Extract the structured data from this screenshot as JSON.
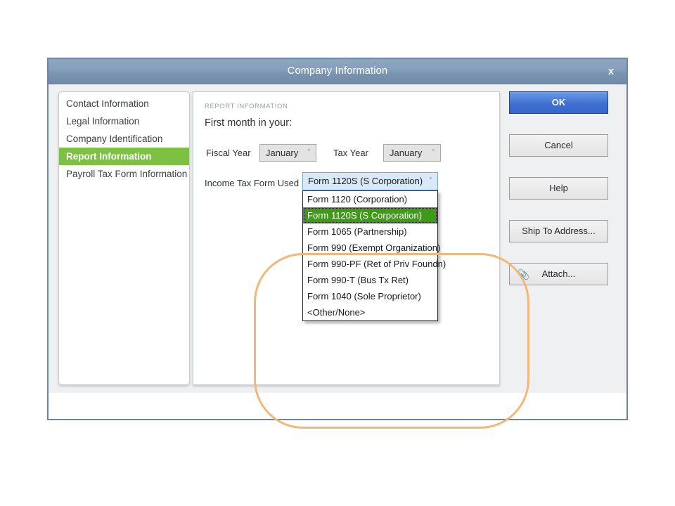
{
  "window": {
    "title": "Company Information",
    "close_label": "x"
  },
  "sidebar": {
    "items": [
      {
        "label": "Contact Information",
        "selected": false
      },
      {
        "label": "Legal Information",
        "selected": false
      },
      {
        "label": "Company Identification",
        "selected": false
      },
      {
        "label": "Report Information",
        "selected": true
      },
      {
        "label": "Payroll Tax Form Information",
        "selected": false
      }
    ]
  },
  "content": {
    "section_label": "REPORT INFORMATION",
    "heading": "First month in your:",
    "fiscal_year": {
      "label": "Fiscal Year",
      "value": "January",
      "caret": "ˇ"
    },
    "tax_year": {
      "label": "Tax Year",
      "value": "January",
      "caret": "ˇ"
    },
    "income_tax_form": {
      "label": "Income Tax Form Used",
      "value": "Form 1120S (S Corporation)",
      "caret": "ˇ",
      "options": [
        {
          "label": "Form 1120 (Corporation)",
          "highlighted": false
        },
        {
          "label": "Form 1120S (S Corporation)",
          "highlighted": true
        },
        {
          "label": "Form 1065 (Partnership)",
          "highlighted": false
        },
        {
          "label": "Form 990 (Exempt Organization)",
          "highlighted": false
        },
        {
          "label": "Form 990-PF (Ret of Priv Foundn)",
          "highlighted": false
        },
        {
          "label": "Form 990-T (Bus Tx Ret)",
          "highlighted": false
        },
        {
          "label": "Form 1040 (Sole Proprietor)",
          "highlighted": false
        },
        {
          "label": "<Other/None>",
          "highlighted": false
        }
      ]
    }
  },
  "buttons": [
    {
      "label": "OK",
      "primary": true,
      "icon": ""
    },
    {
      "label": "Cancel",
      "primary": false,
      "icon": ""
    },
    {
      "label": "Help",
      "primary": false,
      "icon": ""
    },
    {
      "label": "Ship To Address...",
      "primary": false,
      "icon": ""
    },
    {
      "label": "Attach...",
      "primary": false,
      "icon": "📎"
    }
  ],
  "colors": {
    "accent_green": "#7ec142",
    "highlight_green": "#3e9b16",
    "titlebar_blue": "#85a0ba",
    "primary_button": "#3f6fd0",
    "annotation_orange": "#f2b87a",
    "combo_blue": "#dae9f7"
  }
}
